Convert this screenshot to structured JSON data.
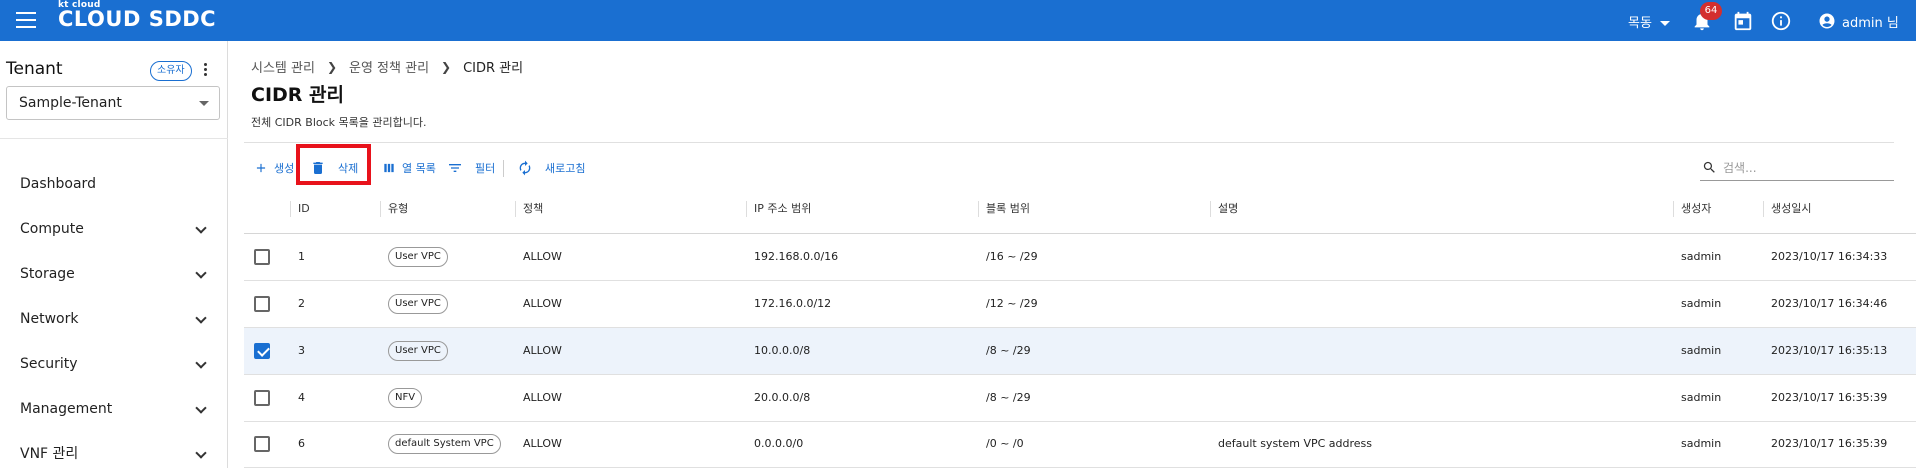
{
  "header": {
    "logo_small": "kt cloud",
    "logo_big": "CLOUD SDDC",
    "language": "목동",
    "notification_count": "64",
    "user_label": "admin 님"
  },
  "sidebar": {
    "tenant_title": "Tenant",
    "owner_badge": "소유자",
    "tenant_selected": "Sample-Tenant",
    "items": [
      {
        "label": "Dashboard"
      },
      {
        "label": "Compute"
      },
      {
        "label": "Storage"
      },
      {
        "label": "Network"
      },
      {
        "label": "Security"
      },
      {
        "label": "Management"
      },
      {
        "label": "VNF 관리"
      }
    ]
  },
  "breadcrumb": [
    "시스템 관리",
    "운영 정책 관리",
    "CIDR 관리"
  ],
  "page": {
    "title": "CIDR 관리",
    "description": "전체 CIDR Block 목록을 관리합니다."
  },
  "toolbar": {
    "create": "생성",
    "delete": "삭제",
    "columns": "열 목록",
    "filter": "필터",
    "refresh": "새로고침",
    "search_placeholder": "검색..."
  },
  "table": {
    "columns": [
      "ID",
      "유형",
      "정책",
      "IP 주소 범위",
      "블록 범위",
      "설명",
      "생성자",
      "생성일시"
    ],
    "rows": [
      {
        "checked": false,
        "id": "1",
        "type": "User VPC",
        "policy": "ALLOW",
        "ip_range": "192.168.0.0/16",
        "block_range": "/16 ~ /29",
        "description": "",
        "creator": "sadmin",
        "created_at": "2023/10/17 16:34:33"
      },
      {
        "checked": false,
        "id": "2",
        "type": "User VPC",
        "policy": "ALLOW",
        "ip_range": "172.16.0.0/12",
        "block_range": "/12 ~ /29",
        "description": "",
        "creator": "sadmin",
        "created_at": "2023/10/17 16:34:46"
      },
      {
        "checked": true,
        "id": "3",
        "type": "User VPC",
        "policy": "ALLOW",
        "ip_range": "10.0.0.0/8",
        "block_range": "/8 ~ /29",
        "description": "",
        "creator": "sadmin",
        "created_at": "2023/10/17 16:35:13"
      },
      {
        "checked": false,
        "id": "4",
        "type": "NFV",
        "policy": "ALLOW",
        "ip_range": "20.0.0.0/8",
        "block_range": "/8 ~ /29",
        "description": "",
        "creator": "sadmin",
        "created_at": "2023/10/17 16:35:39"
      },
      {
        "checked": false,
        "id": "6",
        "type": "default System VPC",
        "policy": "ALLOW",
        "ip_range": "0.0.0.0/0",
        "block_range": "/0 ~ /0",
        "description": "default system VPC address",
        "creator": "sadmin",
        "created_at": "2023/10/17 16:35:39"
      }
    ]
  },
  "colors": {
    "brand": "#1a6fd1",
    "highlight": "#e8121b",
    "selected_row": "#edf3fb",
    "badge": "#d32f2f"
  }
}
